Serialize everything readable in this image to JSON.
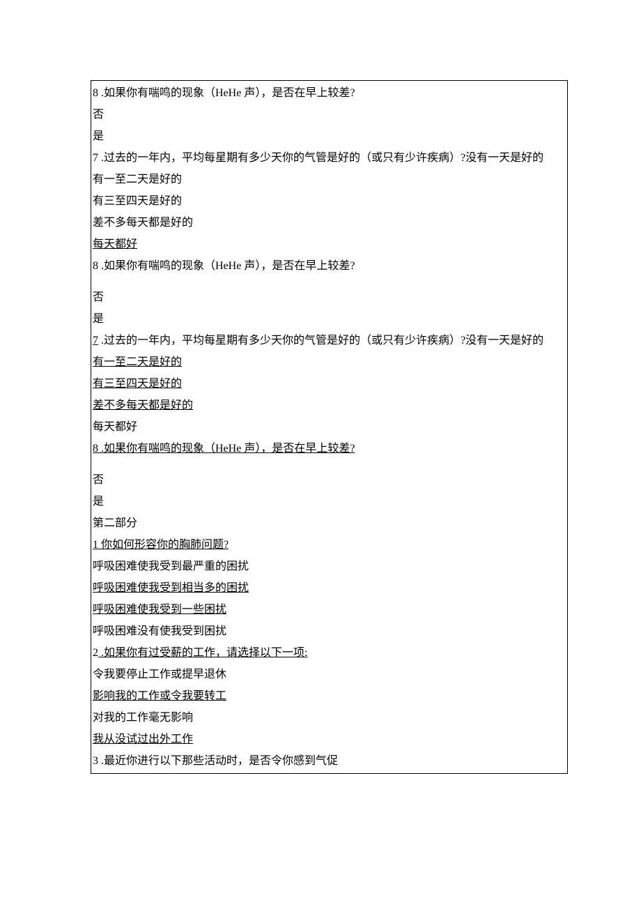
{
  "lines": {
    "l1_num": "8",
    "l1_text": " .如果你有喘鸣的现象（HeHe 声），是否在早上较差?",
    "l2": "否",
    "l3": "是",
    "l4_num": "7",
    "l4_text": " .过去的一年内，平均每星期有多少天你的气管是好的（或只有少许疾病）?没有一天是好的",
    "l5": "有一至二天是好的",
    "l6": "有三至四天是好的",
    "l7": "差不多每天都是好的",
    "l8": "每天都好",
    "l9_num": "8",
    "l9_text": " .如果你有喘鸣的现象（HeHe 声），是否在早上较差?",
    "l10": "否",
    "l11": "是",
    "l12_num": "7",
    "l12_text": " .过去的一年内，平均每星期有多少天你的气管是好的（或只有少许疾病）?没有一天是好的",
    "l13": "有一至二天是好的",
    "l14": "有三至四天是好的",
    "l15": "差不多每天都是好的",
    "l16": "每天都好",
    "l17_num": "8",
    "l17_text": " .如果你有喘鸣的现象（HeHe 声），是否在早上较差?",
    "l18": "否",
    "l19": "是",
    "l20": "第二部分",
    "l21": "1 你如何形容你的胸肺问题?",
    "l22": "呼吸困难使我受到最严重的困扰",
    "l23": "呼吸困难使我受到相当多的困扰",
    "l24": "呼吸困难使我受到一些困扰",
    "l25": "呼吸困难没有使我受到困扰",
    "l26_num": "2",
    "l26_text": "  .如果你有过受薪的工作，请选择以下一项:",
    "l27": "令我要停止工作或提早退休",
    "l28": "影响我的工作或令我要转工",
    "l29": "对我的工作毫无影响",
    "l30": "我从没试过出外工作",
    "l31_num": "3",
    "l31_text": "  .最近你进行以下那些活动时，是否令你感到气促"
  }
}
